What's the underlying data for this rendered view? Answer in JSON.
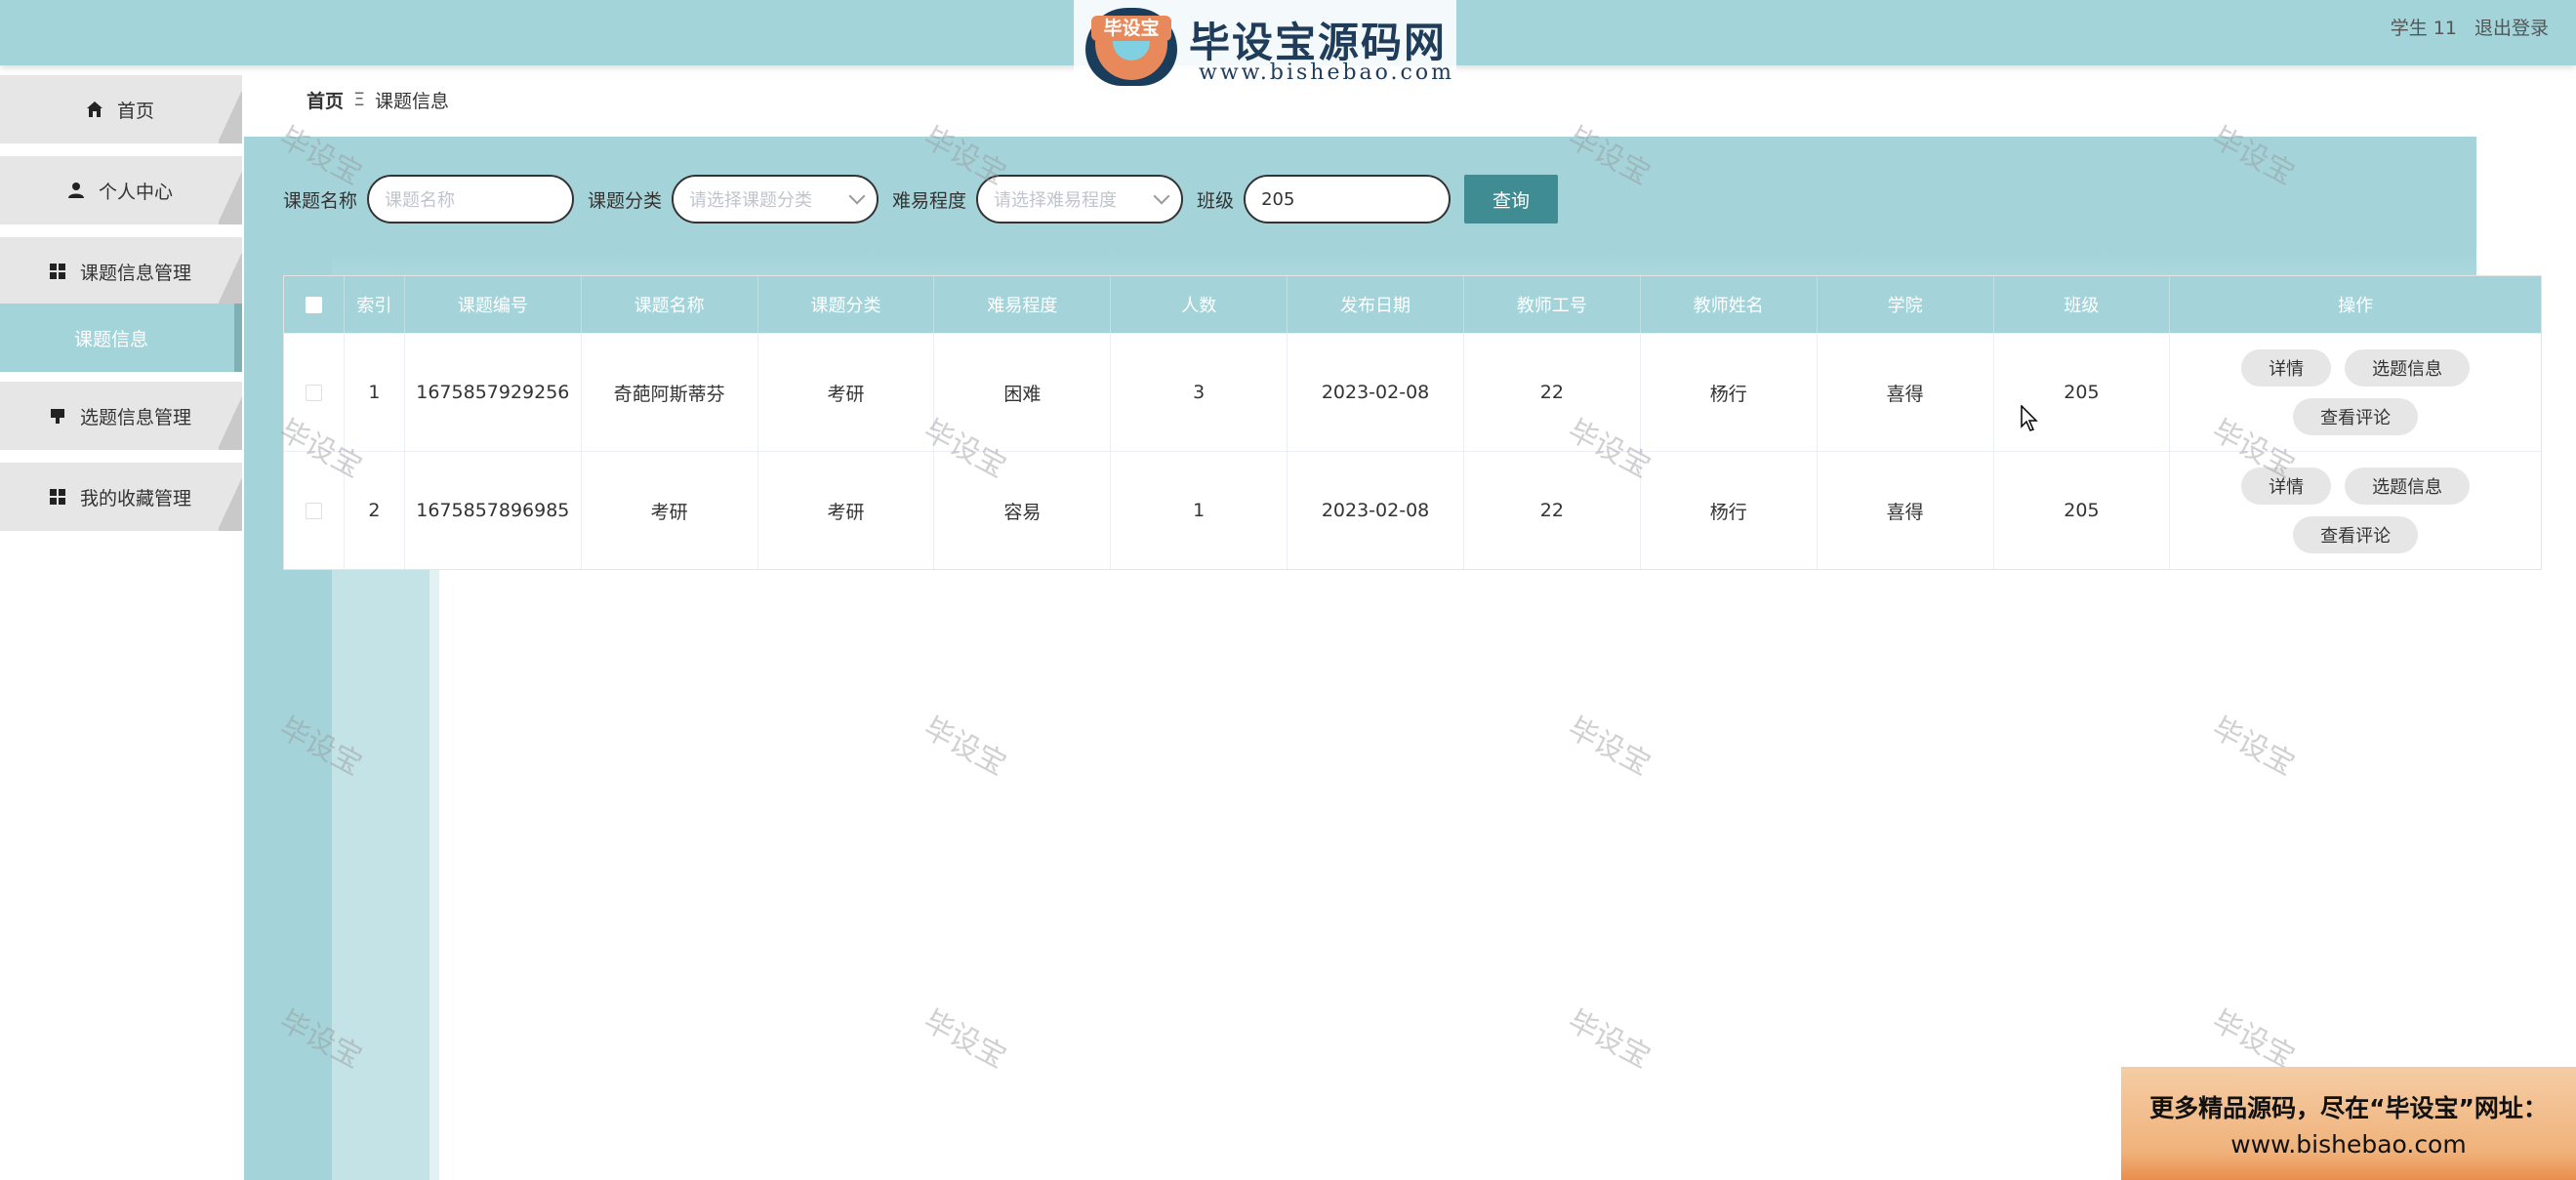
{
  "header": {
    "logo_badge": "毕设宝",
    "logo_title": "毕设宝源码网",
    "logo_url": "www.bishebao.com",
    "user_label": "学生 11",
    "logout_label": "退出登录"
  },
  "sidebar": {
    "items": [
      {
        "label": "首页",
        "icon": "home-icon"
      },
      {
        "label": "个人中心",
        "icon": "person-icon"
      },
      {
        "label": "课题信息管理",
        "icon": "grid-icon"
      },
      {
        "label": "选题信息管理",
        "icon": "card-icon"
      },
      {
        "label": "我的收藏管理",
        "icon": "grid-icon"
      }
    ],
    "sub_item": "课题信息"
  },
  "breadcrumb": {
    "home": "首页",
    "separator": "Ξ",
    "current": "课题信息"
  },
  "search": {
    "name_label": "课题名称",
    "name_placeholder": "课题名称",
    "category_label": "课题分类",
    "category_placeholder": "请选择课题分类",
    "difficulty_label": "难易程度",
    "difficulty_placeholder": "请选择难易程度",
    "class_label": "班级",
    "class_value": "205",
    "query_button": "查询"
  },
  "table": {
    "headers": [
      "索引",
      "课题编号",
      "课题名称",
      "课题分类",
      "难易程度",
      "人数",
      "发布日期",
      "教师工号",
      "教师姓名",
      "学院",
      "班级",
      "操作"
    ],
    "rows": [
      [
        "1",
        "1675857929256",
        "奇葩阿斯蒂芬",
        "考研",
        "困难",
        "3",
        "2023-02-08",
        "22",
        "杨行",
        "喜得",
        "205"
      ],
      [
        "2",
        "1675857896985",
        "考研",
        "考研",
        "容易",
        "1",
        "2023-02-08",
        "22",
        "杨行",
        "喜得",
        "205"
      ]
    ],
    "actions": {
      "detail": "详情",
      "select": "选题信息",
      "comments": "查看评论"
    }
  },
  "watermark": "毕设宝",
  "promo": {
    "line1": "更多精品源码，尽在“毕设宝”网址：",
    "line2": "www.bishebao.com"
  },
  "colors": {
    "accent": "#a2d4da",
    "button": "#3f8c92"
  }
}
